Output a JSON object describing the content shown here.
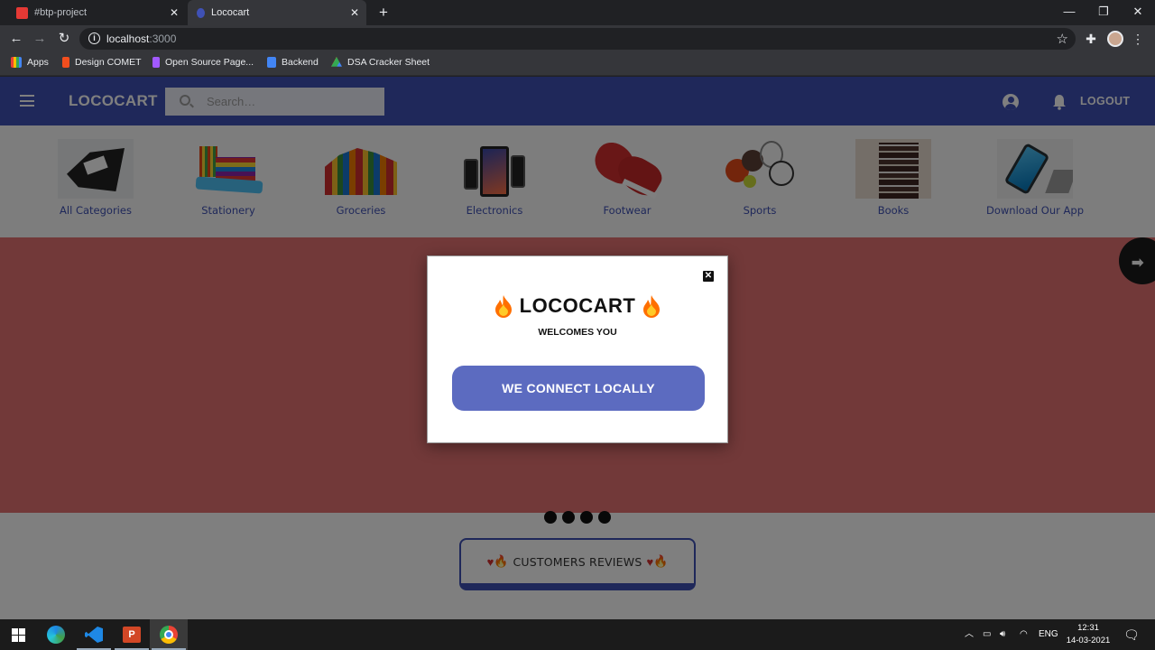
{
  "browser": {
    "tabs": [
      {
        "title": "#btp-project",
        "active": false
      },
      {
        "title": "Lococart",
        "active": true
      }
    ],
    "url_host": "localhost",
    "url_port": ":3000",
    "bookmarks": [
      {
        "label": "Apps",
        "icon": "apps-grid-icon"
      },
      {
        "label": "Design COMET",
        "icon": "figma-icon"
      },
      {
        "label": "Open Source Page...",
        "icon": "figma-icon"
      },
      {
        "label": "Backend",
        "icon": "docs-icon"
      },
      {
        "label": "DSA Cracker Sheet",
        "icon": "drive-icon"
      }
    ]
  },
  "app": {
    "brand": "LOCOCART",
    "search_placeholder": "Search…",
    "logout_label": "LOGOUT",
    "accent_color": "#3f51b5"
  },
  "categories": [
    {
      "label": "All Categories"
    },
    {
      "label": "Stationery"
    },
    {
      "label": "Groceries"
    },
    {
      "label": "Electronics"
    },
    {
      "label": "Footwear"
    },
    {
      "label": "Sports"
    },
    {
      "label": "Books"
    },
    {
      "label": "Download Our App"
    }
  ],
  "carousel": {
    "slide_count": 4,
    "banner_color": "#e57373"
  },
  "reviews": {
    "label": "CUSTOMERS REVIEWS"
  },
  "dialog": {
    "title": "LOCOCART",
    "subtitle": "WELCOMES YOU",
    "button_label": "WE CONNECT LOCALLY"
  },
  "taskbar": {
    "language": "ENG",
    "time": "12:31",
    "date": "14-03-2021"
  }
}
